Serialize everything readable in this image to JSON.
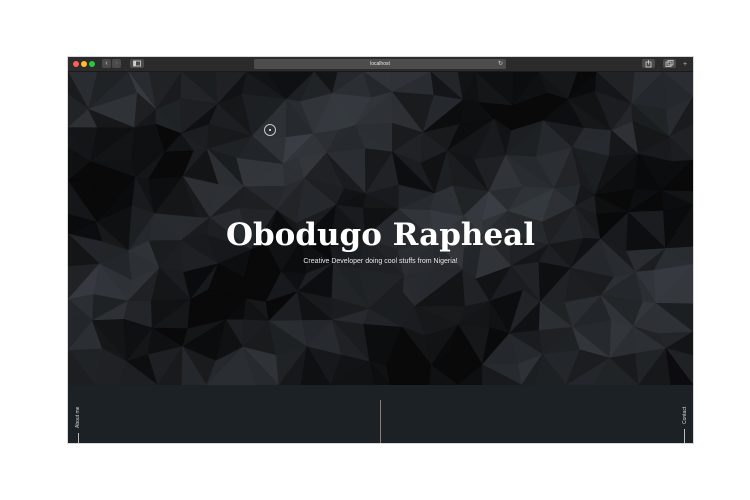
{
  "browser": {
    "url": "localhost",
    "back_icon": "‹",
    "forward_icon": "›",
    "reload_icon": "↻",
    "new_tab_icon": "+"
  },
  "hero": {
    "title": "Obodugo Rapheal",
    "subtitle": "Creative Developer doing cool stuffs from Nigeria!"
  },
  "footer": {
    "about_label": "About me",
    "contact_label": "Contact"
  },
  "colors": {
    "background": "#1c2126",
    "divider": "#8a7f6e",
    "title": "#ffffff"
  }
}
